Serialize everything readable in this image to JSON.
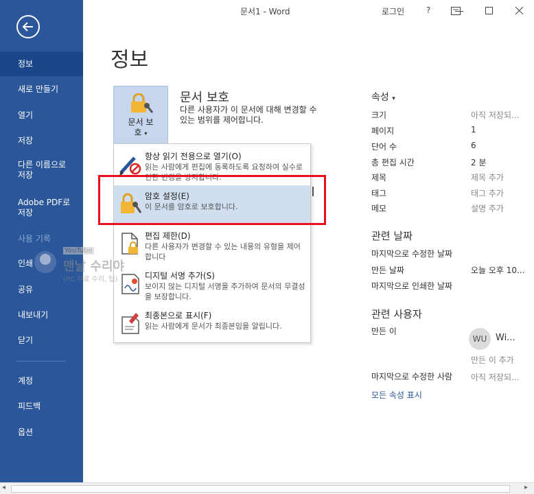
{
  "window": {
    "title": "문서1  -  Word",
    "login": "로그인",
    "help": "?"
  },
  "sidebar": {
    "items": [
      {
        "label": "정보"
      },
      {
        "label": "새로 만들기"
      },
      {
        "label": "열기"
      },
      {
        "label": "저장"
      },
      {
        "label": "다른 이름으로\n저장"
      },
      {
        "label": "Adobe PDF로\n저장"
      },
      {
        "label": "사용 기록"
      },
      {
        "label": "인쇄"
      },
      {
        "label": "공유"
      },
      {
        "label": "내보내기"
      },
      {
        "label": "닫기"
      },
      {
        "label": "계정"
      },
      {
        "label": "피드백"
      },
      {
        "label": "옵션"
      }
    ]
  },
  "page": {
    "title": "정보"
  },
  "protect": {
    "button_label": "문서 보",
    "button_label2": "호",
    "heading": "문서 보호",
    "description": "다른 사용자가 이 문서에 대해 변경할 수 있는 범위를 제어합니다."
  },
  "menu": {
    "items": [
      {
        "title": "항상 읽기 전용으로 열기(O)",
        "desc": "읽는 사람에게 편집에 동록하도록 요청하여 실수로 인한 변경을 방지합니다."
      },
      {
        "title": "암호 설정(E)",
        "desc": "이 문서를 암호로 보호합니다."
      },
      {
        "title": "편집 제한(D)",
        "desc": "다른 사용자가 변경할 수 있는 내용의 유형을 제어합니다"
      },
      {
        "title": "디지털 서명 추가(S)",
        "desc": "보이지 않는 디지털 서명을 추가하여 문서의 무결성을 보장합니다."
      },
      {
        "title": "최종본으로 표시(F)",
        "desc": "읽는 사람에게 문서가 최종본임을 알립니다."
      }
    ]
  },
  "watermark": {
    "line1": "YouTube",
    "line2": "맨날 수리야",
    "line3": "(PC 무료 수리, 팁)"
  },
  "properties": {
    "heading": "속성",
    "rows": [
      {
        "label": "크기",
        "value": "아직 저장되..."
      },
      {
        "label": "페이지",
        "value": "1"
      },
      {
        "label": "단어 수",
        "value": "6"
      },
      {
        "label": "총 편집 시간",
        "value": "2 분"
      },
      {
        "label": "제목",
        "value": "제목 추가"
      },
      {
        "label": "태그",
        "value": "태그 추가"
      },
      {
        "label": "메모",
        "value": "설명 추가"
      }
    ]
  },
  "dates": {
    "heading": "관련 날짜",
    "rows": [
      {
        "label": "마지막으로 수정한 날짜",
        "value": ""
      },
      {
        "label": "만든 날짜",
        "value": "오늘 오후 10..."
      },
      {
        "label": "마지막으로 인쇄한 날짜",
        "value": ""
      }
    ]
  },
  "people": {
    "heading": "관련 사용자",
    "author_label": "만든 이",
    "avatar_initials": "WU",
    "author_name": "Wi...",
    "add_author": "만든 이 추가",
    "last_modified_label": "마지막으로 수정한 사람",
    "last_modified_value": "아직 저장되...",
    "show_all": "모든 속성 표시"
  },
  "colors": {
    "sidebar": "#2b579a",
    "highlight": "#d0deef",
    "red_outline": "#e8101a",
    "link": "#2b579a"
  }
}
